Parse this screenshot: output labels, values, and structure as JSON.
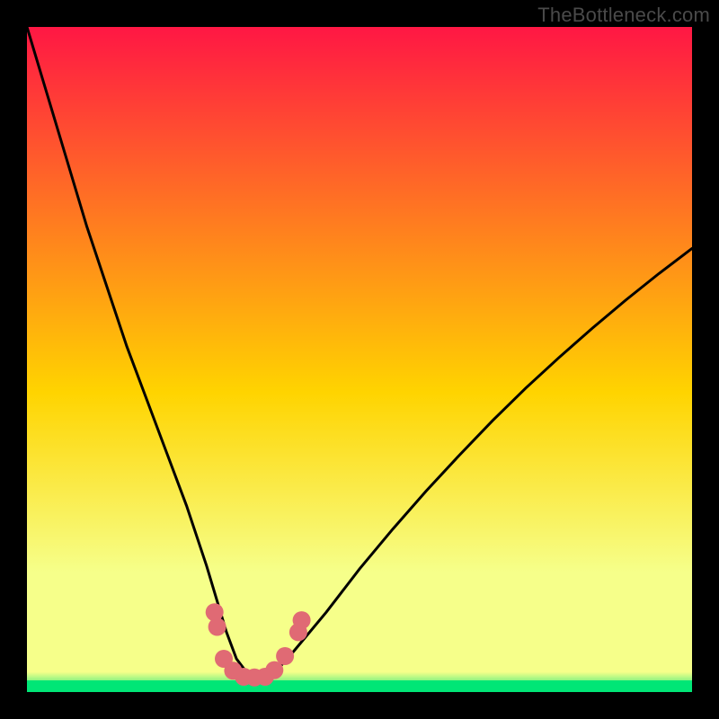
{
  "watermark": "TheBottleneck.com",
  "colors": {
    "top": "#ff1744",
    "mid": "#ffd400",
    "low": "#f6ff8a",
    "green": "#00e676",
    "curve": "#000000",
    "dots": "#e06a74"
  },
  "chart_data": {
    "type": "line",
    "title": "",
    "xlabel": "",
    "ylabel": "",
    "xlim": [
      0,
      100
    ],
    "ylim": [
      0,
      100
    ],
    "x": [
      0,
      3,
      6,
      9,
      12,
      15,
      18,
      21,
      24,
      27,
      28.5,
      30,
      31.5,
      33,
      34.5,
      36,
      37.5,
      40,
      45,
      50,
      55,
      60,
      65,
      70,
      75,
      80,
      85,
      90,
      95,
      100
    ],
    "y": [
      100,
      90,
      80,
      70,
      61,
      52,
      44,
      36,
      28,
      19,
      14,
      9,
      5,
      3,
      2.2,
      2.2,
      3.2,
      6,
      12,
      18.5,
      24.5,
      30.2,
      35.6,
      40.8,
      45.7,
      50.3,
      54.7,
      58.9,
      62.9,
      66.7
    ],
    "dots": [
      {
        "x": 28.2,
        "y": 12.0
      },
      {
        "x": 28.6,
        "y": 9.8
      },
      {
        "x": 29.6,
        "y": 5.0
      },
      {
        "x": 31.0,
        "y": 3.2
      },
      {
        "x": 32.6,
        "y": 2.3
      },
      {
        "x": 34.2,
        "y": 2.2
      },
      {
        "x": 35.8,
        "y": 2.3
      },
      {
        "x": 37.2,
        "y": 3.3
      },
      {
        "x": 38.8,
        "y": 5.4
      },
      {
        "x": 40.8,
        "y": 9.0
      },
      {
        "x": 41.3,
        "y": 10.8
      }
    ]
  }
}
